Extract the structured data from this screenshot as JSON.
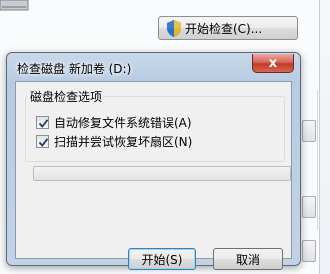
{
  "background_window": {
    "check_now_button": "开始检查(C)..."
  },
  "dialog": {
    "title": "检查磁盘 新加卷 (D:)",
    "close_label": "x",
    "options_group": {
      "label": "磁盘检查选项",
      "options": [
        {
          "label": "自动修复文件系统错误(A)",
          "checked": true
        },
        {
          "label": "扫描并尝试恢复坏扇区(N)",
          "checked": true
        }
      ]
    },
    "progress": 0,
    "buttons": {
      "start": "开始(S)",
      "cancel": "取消"
    }
  },
  "colors": {
    "dialog_frame": "#b8cbe2",
    "close_button": "#c23b2c",
    "progress_fill": "#37c52a"
  }
}
